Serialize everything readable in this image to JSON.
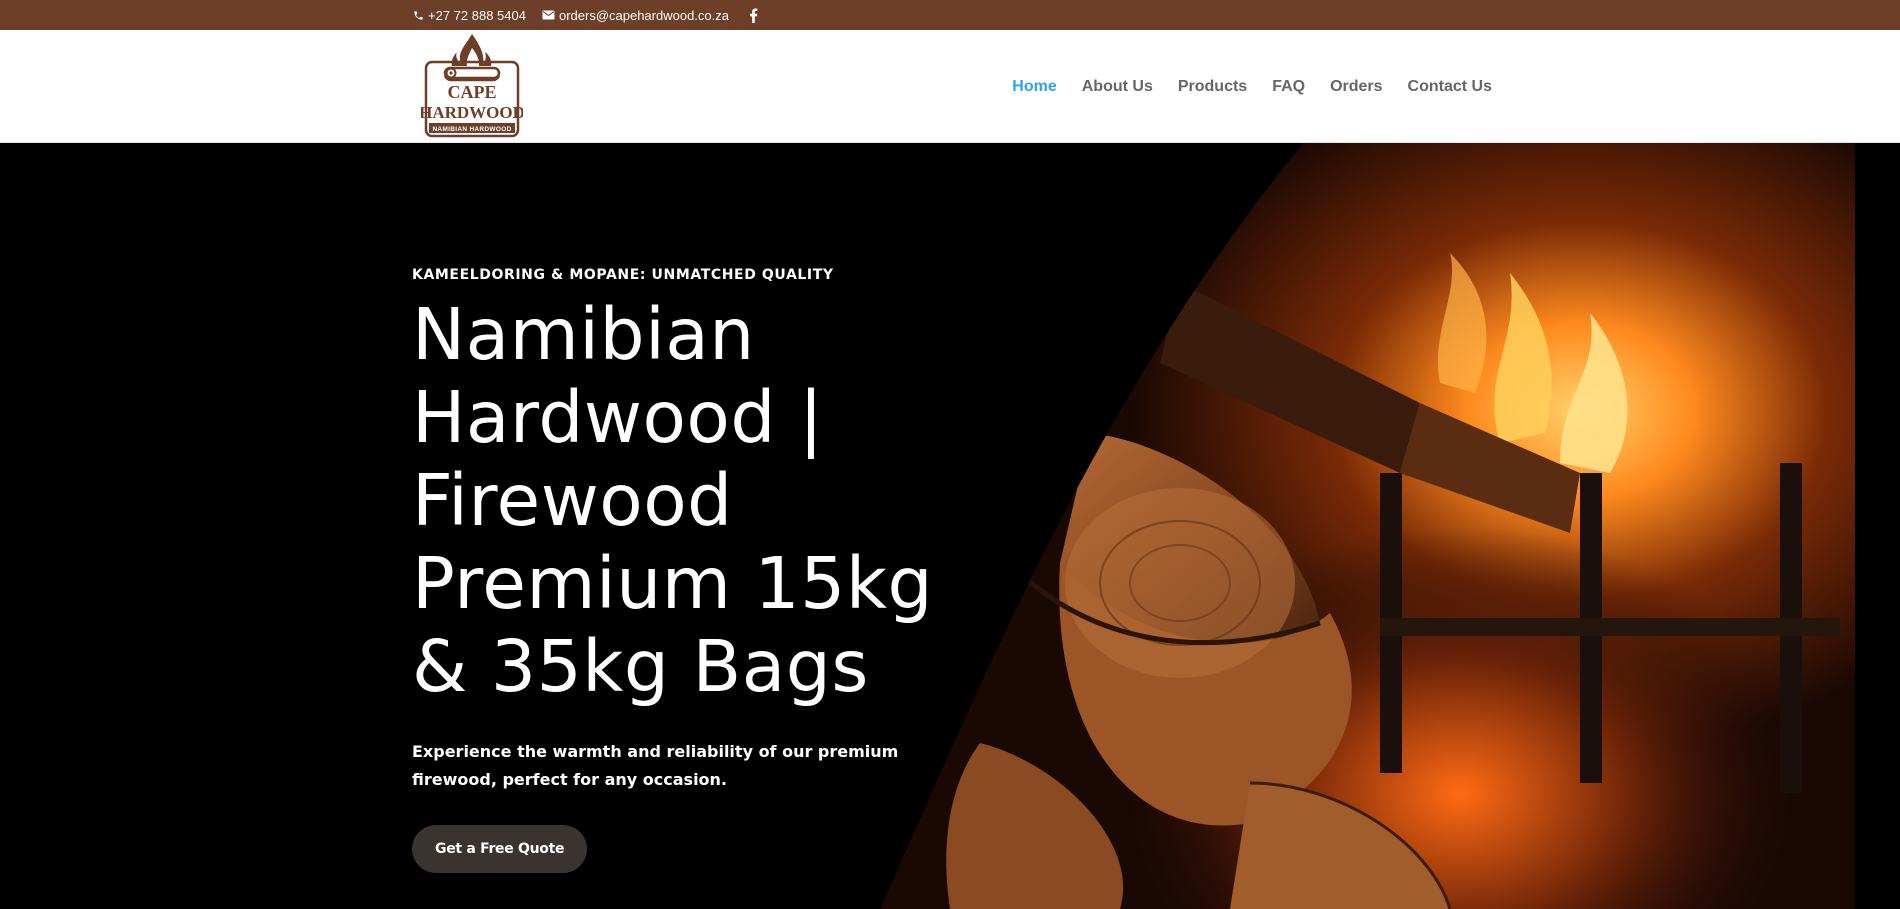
{
  "topbar": {
    "phone": "+27 72 888 5404",
    "email": "orders@capehardwood.co.za",
    "social_icon": "facebook-icon"
  },
  "logo": {
    "line1": "CAPE",
    "line2": "HARDWOOD",
    "tagline": "NAMIBIAN HARDWOOD"
  },
  "nav": {
    "items": [
      {
        "label": "Home",
        "active": true
      },
      {
        "label": "About Us"
      },
      {
        "label": "Products"
      },
      {
        "label": "FAQ"
      },
      {
        "label": "Orders"
      },
      {
        "label": "Contact Us"
      }
    ]
  },
  "hero": {
    "kicker": "KAMEELDORING & MOPANE: UNMATCHED QUALITY",
    "headline": "Namibian Hardwood | Firewood Premium 15kg & 35kg Bags",
    "subtext": "Experience the warmth and reliability of our premium firewood, perfect for any occasion.",
    "cta_label": "Get a Free Quote"
  },
  "colors": {
    "topbar_bg": "#6d3e28",
    "nav_active": "#2ea3f2",
    "nav_text": "#666666",
    "hero_bg": "#000000",
    "cta_bg": "#3b3330"
  }
}
